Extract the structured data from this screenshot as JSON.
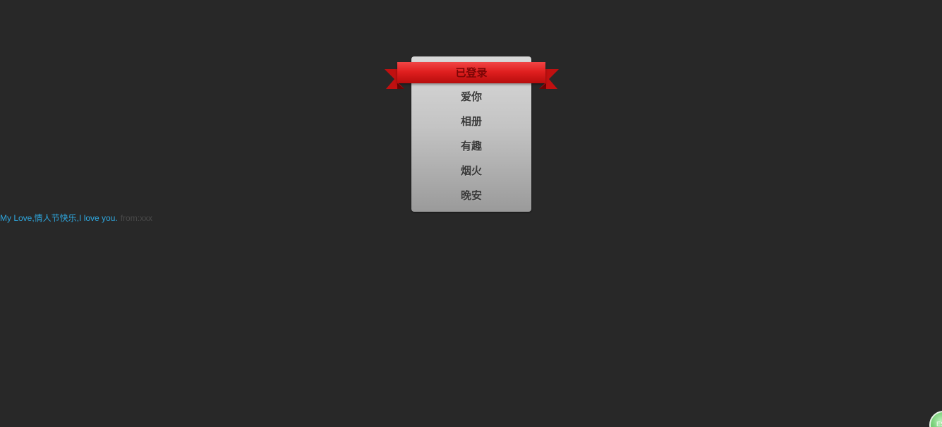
{
  "menu": {
    "active_label": "已登录",
    "items": [
      {
        "label": "爱你"
      },
      {
        "label": "相册"
      },
      {
        "label": "有趣"
      },
      {
        "label": "烟火"
      },
      {
        "label": "晚安"
      }
    ]
  },
  "caption": {
    "message": "My Love,情人节快乐,I love you.",
    "from": "from:xxx"
  },
  "corner_button": {
    "label": "ES"
  },
  "colors": {
    "background": "#282828",
    "ribbon": "#e01f1f",
    "caption_text": "#2ea6dd",
    "corner_button": "#5cc05c"
  }
}
